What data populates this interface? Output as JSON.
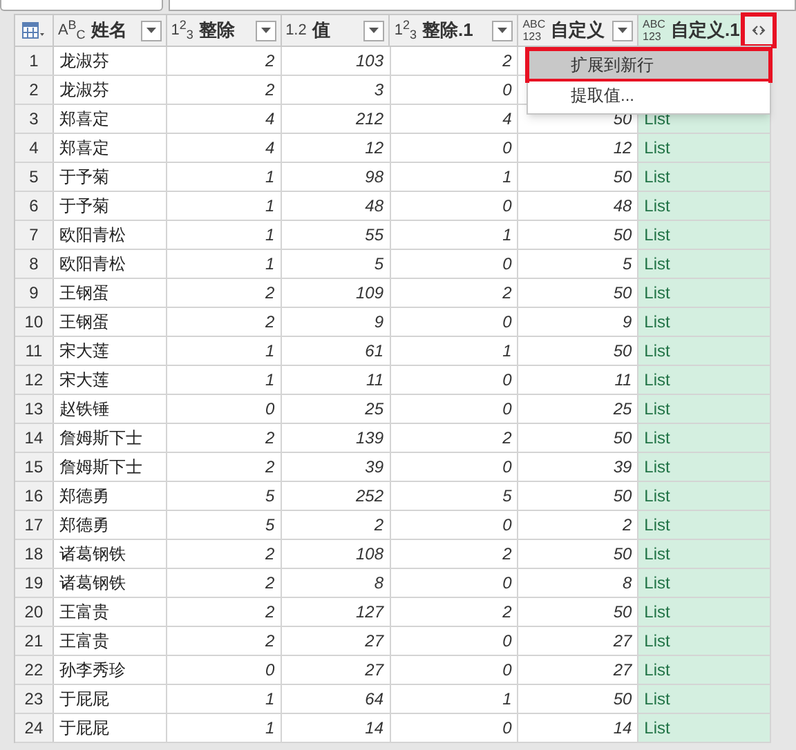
{
  "columns": [
    {
      "label": "姓名",
      "type_label": "ABC",
      "kind": "text",
      "selected": false,
      "expandable": false
    },
    {
      "label": "整除",
      "type_label": "123",
      "kind": "whole",
      "selected": false,
      "expandable": false
    },
    {
      "label": "值",
      "type_label": "1.2",
      "kind": "decimal",
      "selected": false,
      "expandable": false
    },
    {
      "label": "整除.1",
      "type_label": "123",
      "kind": "whole",
      "selected": false,
      "expandable": false
    },
    {
      "label": "自定义",
      "type_label": "ABC 123",
      "kind": "any",
      "selected": false,
      "expandable": false
    },
    {
      "label": "自定义.1",
      "type_label": "ABC 123",
      "kind": "any",
      "selected": true,
      "expandable": true,
      "highlighted": true
    }
  ],
  "rows": [
    [
      "1",
      "龙淑芬",
      "2",
      "103",
      "2",
      null,
      null
    ],
    [
      "2",
      "龙淑芬",
      "2",
      "3",
      "0",
      null,
      null
    ],
    [
      "3",
      "郑喜定",
      "4",
      "212",
      "4",
      "50",
      "List"
    ],
    [
      "4",
      "郑喜定",
      "4",
      "12",
      "0",
      "12",
      "List"
    ],
    [
      "5",
      "于予菊",
      "1",
      "98",
      "1",
      "50",
      "List"
    ],
    [
      "6",
      "于予菊",
      "1",
      "48",
      "0",
      "48",
      "List"
    ],
    [
      "7",
      "欧阳青松",
      "1",
      "55",
      "1",
      "50",
      "List"
    ],
    [
      "8",
      "欧阳青松",
      "1",
      "5",
      "0",
      "5",
      "List"
    ],
    [
      "9",
      "王钢蛋",
      "2",
      "109",
      "2",
      "50",
      "List"
    ],
    [
      "10",
      "王钢蛋",
      "2",
      "9",
      "0",
      "9",
      "List"
    ],
    [
      "11",
      "宋大莲",
      "1",
      "61",
      "1",
      "50",
      "List"
    ],
    [
      "12",
      "宋大莲",
      "1",
      "11",
      "0",
      "11",
      "List"
    ],
    [
      "13",
      "赵铁锤",
      "0",
      "25",
      "0",
      "25",
      "List"
    ],
    [
      "14",
      "詹姆斯下士",
      "2",
      "139",
      "2",
      "50",
      "List"
    ],
    [
      "15",
      "詹姆斯下士",
      "2",
      "39",
      "0",
      "39",
      "List"
    ],
    [
      "16",
      "郑德勇",
      "5",
      "252",
      "5",
      "50",
      "List"
    ],
    [
      "17",
      "郑德勇",
      "5",
      "2",
      "0",
      "2",
      "List"
    ],
    [
      "18",
      "诸葛钢铁",
      "2",
      "108",
      "2",
      "50",
      "List"
    ],
    [
      "19",
      "诸葛钢铁",
      "2",
      "8",
      "0",
      "8",
      "List"
    ],
    [
      "20",
      "王富贵",
      "2",
      "127",
      "2",
      "50",
      "List"
    ],
    [
      "21",
      "王富贵",
      "2",
      "27",
      "0",
      "27",
      "List"
    ],
    [
      "22",
      "孙李秀珍",
      "0",
      "27",
      "0",
      "27",
      "List"
    ],
    [
      "23",
      "于屁屁",
      "1",
      "64",
      "1",
      "50",
      "List"
    ],
    [
      "24",
      "于屁屁",
      "1",
      "14",
      "0",
      "14",
      "List"
    ]
  ],
  "menu": {
    "items": [
      {
        "label": "扩展到新行",
        "selected": true
      },
      {
        "label": "提取值...",
        "selected": false
      }
    ]
  }
}
